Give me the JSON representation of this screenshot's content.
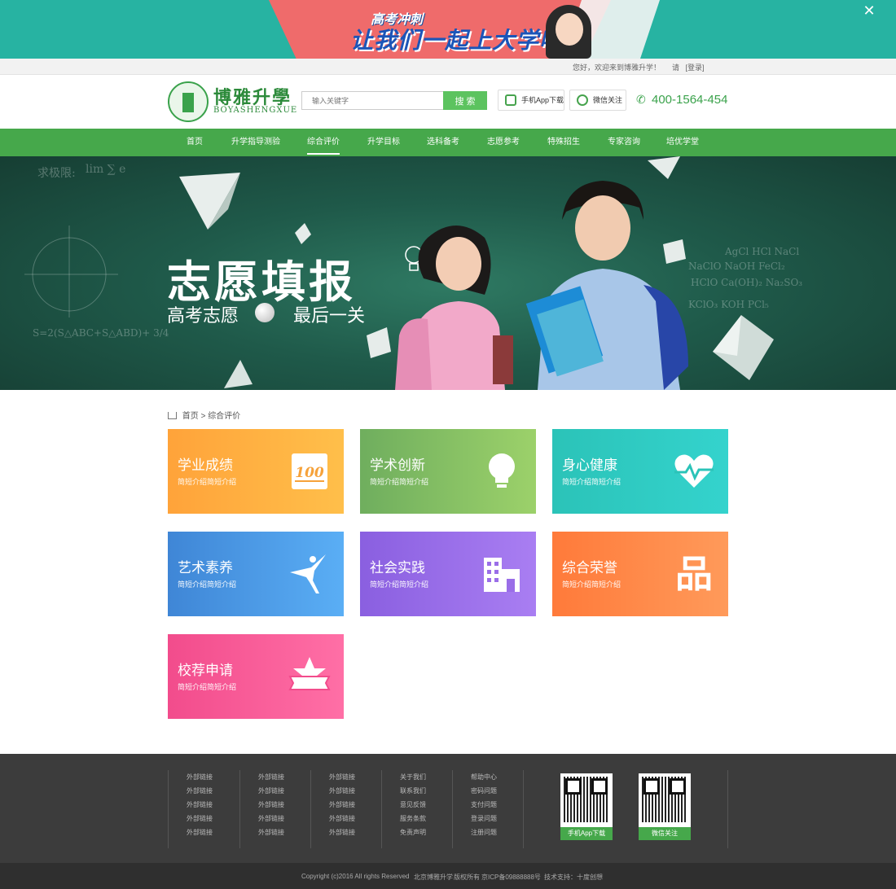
{
  "promo": {
    "slogan_top": "高考冲刺",
    "slogan_main": "让我们一起上大学吧",
    "close_label": "✕"
  },
  "topbar": {
    "greeting": "您好，欢迎来到博雅升学！",
    "login_prefix": "请",
    "login_link": "[登录]"
  },
  "header": {
    "logo_text": "博雅升學",
    "logo_sub": "BOYASHENGXUE",
    "search_placeholder": "输入关键字",
    "search_button": "搜 索",
    "app_download": "手机App下载",
    "wechat_follow": "微信关注",
    "phone": "400-1564-454"
  },
  "nav": {
    "items": [
      "首页",
      "升学指导测验",
      "综合评价",
      "升学目标",
      "选科备考",
      "志愿参考",
      "特殊招生",
      "专家咨询",
      "培优学堂"
    ],
    "active_index": 2
  },
  "hero": {
    "title": "志愿填报",
    "subtitle_left": "高考志愿",
    "subtitle_right": "最后一关",
    "formula_1": "求极限:",
    "formula_2": "lim ∑ e",
    "formula_3": "S=2(S△ABC+S△ABD)+ 3/4",
    "formula_4": "AgCl  HCl  NaCl",
    "formula_5": "NaClO  NaOH  FeCl₂",
    "formula_6": "HClO  Ca(OH)₂  Na₂SO₃",
    "formula_7": "KClO₃  KOH  PCl₅"
  },
  "breadcrumb": {
    "home": "首页",
    "sep": ">",
    "current": "综合评价"
  },
  "cards": [
    {
      "title": "学业成绩",
      "desc": "简短介绍简短介绍",
      "icon": "score-100-icon",
      "from": "#ffa33a",
      "to": "#ffbf4a"
    },
    {
      "title": "学术创新",
      "desc": "简短介绍简短介绍",
      "icon": "lightbulb-icon",
      "from": "#6fae5e",
      "to": "#9cd16a"
    },
    {
      "title": "身心健康",
      "desc": "简短介绍简短介绍",
      "icon": "heart-pulse-icon",
      "from": "#2bc3b8",
      "to": "#34d3cd"
    },
    {
      "title": "艺术素养",
      "desc": "简短介绍简短介绍",
      "icon": "dancer-icon",
      "from": "#3f86d6",
      "to": "#5aaef5"
    },
    {
      "title": "社会实践",
      "desc": "简短介绍简短介绍",
      "icon": "building-icon",
      "from": "#8a5fe0",
      "to": "#a97ef2"
    },
    {
      "title": "综合荣誉",
      "desc": "简短介绍简短介绍",
      "icon": "pin-character-icon",
      "glyph": "品",
      "from": "#ff7a3a",
      "to": "#ff9a5a"
    },
    {
      "title": "校荐申请",
      "desc": "简短介绍简短介绍",
      "icon": "star-badge-icon",
      "from": "#f24c8c",
      "to": "#ff6fa6"
    }
  ],
  "footer": {
    "columns": [
      [
        "外部链接",
        "外部链接",
        "外部链接",
        "外部链接",
        "外部链接"
      ],
      [
        "外部链接",
        "外部链接",
        "外部链接",
        "外部链接",
        "外部链接"
      ],
      [
        "外部链接",
        "外部链接",
        "外部链接",
        "外部链接",
        "外部链接"
      ],
      [
        "关于我们",
        "联系我们",
        "意见反馈",
        "服务条款",
        "免责声明"
      ],
      [
        "帮助中心",
        "密码问题",
        "支付问题",
        "登录问题",
        "注册问题"
      ]
    ],
    "qr_app_caption": "手机App下载",
    "qr_wx_caption": "微信关注"
  },
  "copyright": {
    "text": "Copyright (c)2016 All rights Reserved",
    "company": "北京博雅升学",
    "rights": "版权所有",
    "icp": "京ICP备09888888号",
    "support": "技术支持：十度创想"
  },
  "colors": {
    "brand_green": "#46a84b",
    "promo_teal": "#27b3a2",
    "footer_bg": "#3c3c3c"
  }
}
